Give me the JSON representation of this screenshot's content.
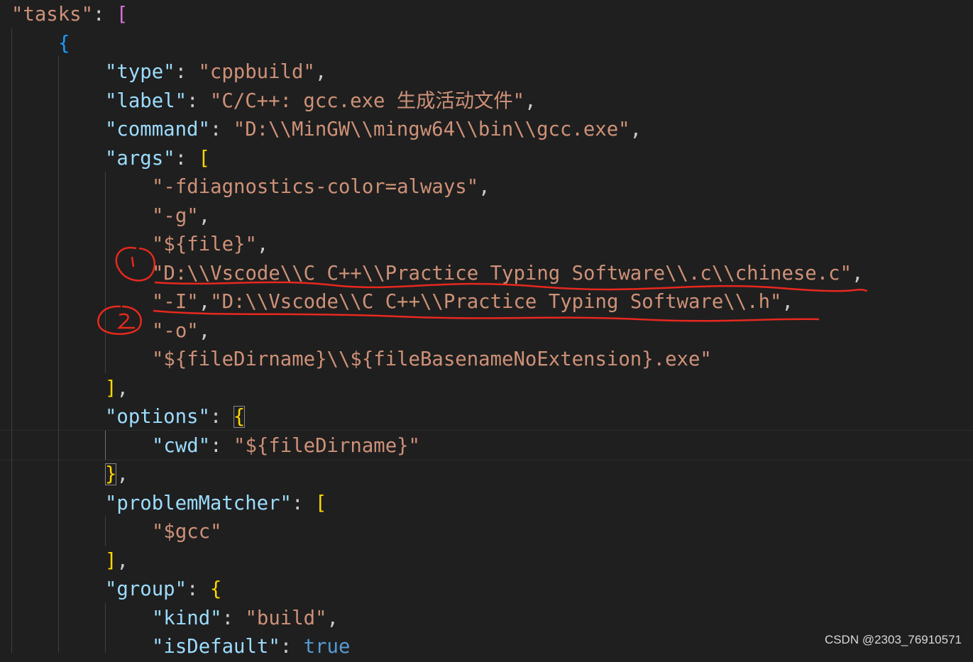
{
  "editor": {
    "lines": [
      [
        [
          "s",
          "\"tasks\""
        ],
        [
          "p",
          ": "
        ],
        [
          "b1",
          "["
        ]
      ],
      [
        [
          "b2",
          "{"
        ]
      ],
      [
        [
          "k",
          "\"type\""
        ],
        [
          "p",
          ": "
        ],
        [
          "s",
          "\"cppbuild\""
        ],
        [
          "p",
          ","
        ]
      ],
      [
        [
          "k",
          "\"label\""
        ],
        [
          "p",
          ": "
        ],
        [
          "s",
          "\"C/C++: gcc.exe 生成活动文件\""
        ],
        [
          "p",
          ","
        ]
      ],
      [
        [
          "k",
          "\"command\""
        ],
        [
          "p",
          ": "
        ],
        [
          "s",
          "\"D:\\\\MinGW\\\\mingw64\\\\bin\\\\gcc.exe\""
        ],
        [
          "p",
          ","
        ]
      ],
      [
        [
          "k",
          "\"args\""
        ],
        [
          "p",
          ": "
        ],
        [
          "b3",
          "["
        ]
      ],
      [
        [
          "s",
          "\"-fdiagnostics-color=always\""
        ],
        [
          "p",
          ","
        ]
      ],
      [
        [
          "s",
          "\"-g\""
        ],
        [
          "p",
          ","
        ]
      ],
      [
        [
          "s",
          "\"${file}\""
        ],
        [
          "p",
          ","
        ]
      ],
      [
        [
          "s",
          "\"D:\\\\Vscode\\\\C C++\\\\Practice Typing Software\\\\.c\\\\chinese.c\""
        ],
        [
          "p",
          ","
        ]
      ],
      [
        [
          "s",
          "\"-I\""
        ],
        [
          "p",
          ","
        ],
        [
          "s",
          "\"D:\\\\Vscode\\\\C C++\\\\Practice Typing Software\\\\.h\""
        ],
        [
          "p",
          ","
        ]
      ],
      [
        [
          "s",
          "\"-o\""
        ],
        [
          "p",
          ","
        ]
      ],
      [
        [
          "s",
          "\"${fileDirname}\\\\${fileBasenameNoExtension}.exe\""
        ]
      ],
      [
        [
          "b3",
          "]"
        ],
        [
          "p",
          ","
        ]
      ],
      [
        [
          "k",
          "\"options\""
        ],
        [
          "p",
          ": "
        ],
        [
          "b3",
          "{"
        ]
      ],
      [
        [
          "k",
          "\"cwd\""
        ],
        [
          "p",
          ": "
        ],
        [
          "s",
          "\"${fileDirname}\""
        ]
      ],
      [
        [
          "b3",
          "}"
        ],
        [
          "p",
          ","
        ]
      ],
      [
        [
          "k",
          "\"problemMatcher\""
        ],
        [
          "p",
          ": "
        ],
        [
          "b3",
          "["
        ]
      ],
      [
        [
          "s",
          "\"$gcc\""
        ]
      ],
      [
        [
          "b3",
          "]"
        ],
        [
          "p",
          ","
        ]
      ],
      [
        [
          "k",
          "\"group\""
        ],
        [
          "p",
          ": "
        ],
        [
          "b3",
          "{"
        ]
      ],
      [
        [
          "k",
          "\"kind\""
        ],
        [
          "p",
          ": "
        ],
        [
          "s",
          "\"build\""
        ],
        [
          "p",
          ","
        ]
      ],
      [
        [
          "k",
          "\"isDefault\""
        ],
        [
          "p",
          ": "
        ],
        [
          "kw",
          "true"
        ]
      ]
    ]
  },
  "annotations": {
    "marker_1": "1",
    "marker_2": "2",
    "color": "#e8281e"
  },
  "watermark": "CSDN @2303_76910571"
}
